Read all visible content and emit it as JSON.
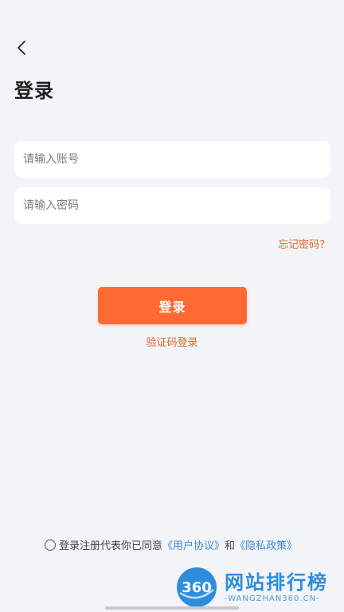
{
  "header": {
    "back_icon": "chevron-left-icon",
    "title": "登录"
  },
  "form": {
    "account_placeholder": "请输入账号",
    "account_value": "",
    "password_placeholder": "请输入密码",
    "password_value": "",
    "forgot_label": "忘记密码?",
    "login_label": "登录",
    "sms_login_label": "验证码登录"
  },
  "agreement": {
    "checked": false,
    "prefix": "登录注册代表你已同意",
    "user_agreement": "《用户协议》",
    "and": "和",
    "privacy_policy": "《隐私政策》"
  },
  "watermark": {
    "logo_text": "360",
    "title": "网站排行榜",
    "subtitle": "-WANGZHAN360.CN-"
  },
  "colors": {
    "accent": "#ff6a34",
    "link_orange": "#e2662c",
    "link_blue": "#3d87d8",
    "background": "#f3f4f8"
  }
}
